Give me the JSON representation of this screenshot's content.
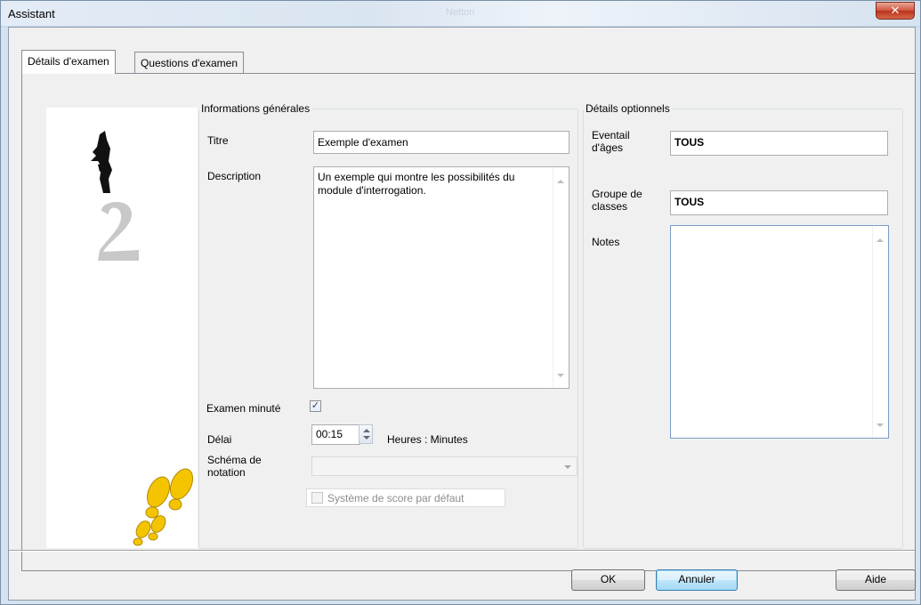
{
  "window": {
    "title": "Assistant",
    "blurred_title": "Netton",
    "close_glyph": "✕"
  },
  "tabs": [
    {
      "label": "Détails d'examen",
      "active": true
    },
    {
      "label": "Questions d'examen",
      "active": false
    }
  ],
  "general": {
    "legend": "Informations générales",
    "title_label": "Titre",
    "title_value": "Exemple d'examen",
    "description_label": "Description",
    "description_value": "Un exemple qui montre les possibilités du module d'interrogation.",
    "timed_label": "Examen minuté",
    "timed_checked": true,
    "check_glyph": "✓",
    "delay_label": "Délai",
    "delay_value": "00:15",
    "delay_units": "Heures : Minutes",
    "scoring_label_line1": "Schéma de",
    "scoring_label_line2": "notation",
    "scoring_value": "",
    "default_score_label": "Système de score par défaut",
    "default_score_checked": false
  },
  "optional": {
    "legend": "Détails optionnels",
    "age_label_line1": "Eventail",
    "age_label_line2": "d'âges",
    "age_value": "TOUS",
    "class_label_line1": "Groupe de",
    "class_label_line2": "classes",
    "class_value": "TOUS",
    "notes_label": "Notes",
    "notes_value": ""
  },
  "buttons": {
    "ok": "OK",
    "cancel": "Annuler",
    "help": "Aide"
  },
  "colors": {
    "step1": "#111111",
    "step2": "#c8c8c8",
    "footprints": "#f4c400",
    "footprints_outline": "#b08a00"
  },
  "icons": {
    "step_one": "step-one-icon",
    "step_two": "step-two-icon",
    "footprints": "footprints-icon"
  }
}
